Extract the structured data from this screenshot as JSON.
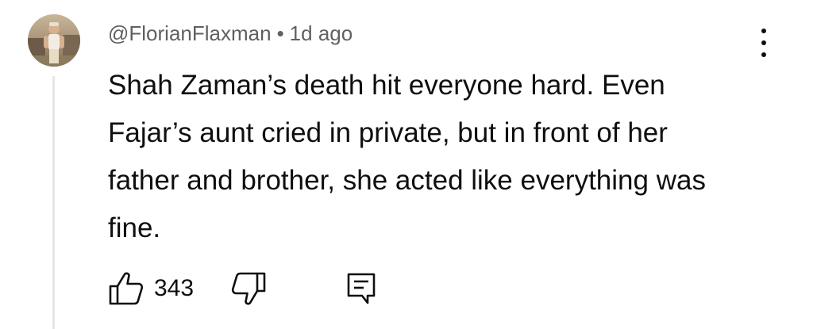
{
  "comment": {
    "author": "@FlorianFlaxman",
    "separator": "•",
    "timestamp": "1d ago",
    "text": "Shah Zaman’s death hit everyone hard. Even Fajar’s aunt cried in private, but in front of her father and brother, she acted like everything was fine.",
    "like_count": "343"
  },
  "icons": {
    "avatar": "avatar-photo",
    "like": "thumbs-up-icon",
    "dislike": "thumbs-down-icon",
    "reply": "reply-comment-icon",
    "more": "more-vertical-icon"
  },
  "colors": {
    "text": "#0f0f0f",
    "meta": "#606060",
    "thread_line": "#e6e6e6"
  }
}
